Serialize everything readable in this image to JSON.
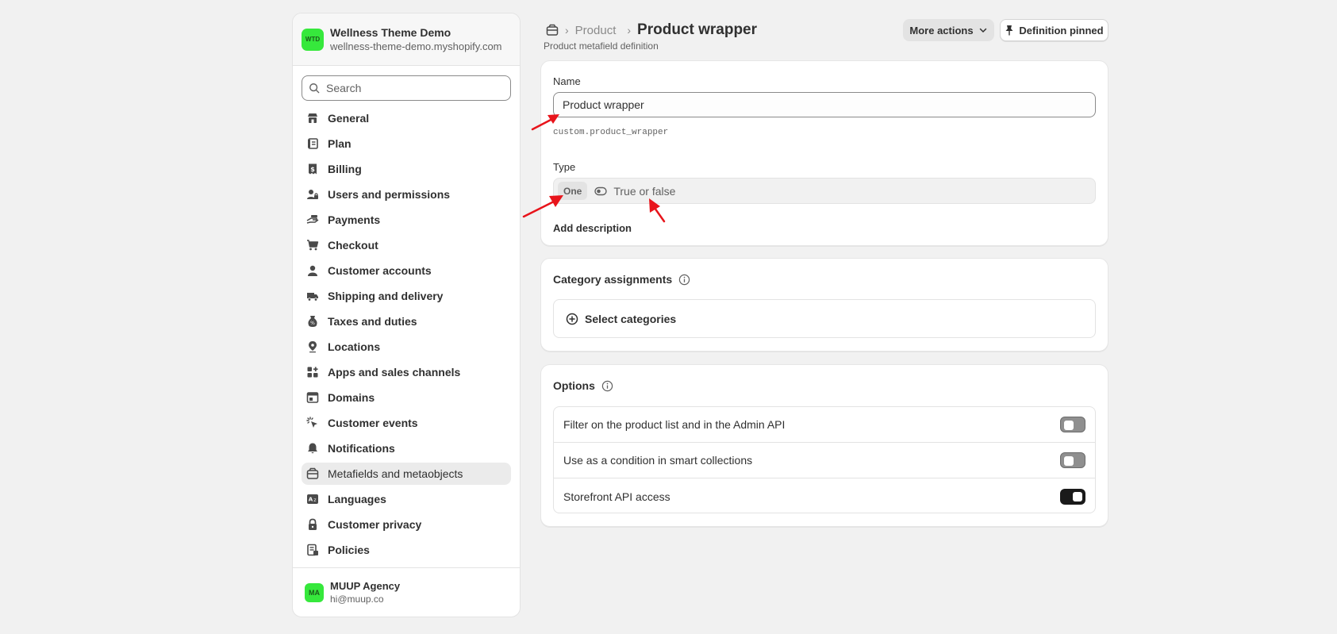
{
  "store": {
    "avatar_initials": "WTD",
    "name": "Wellness Theme Demo",
    "domain": "wellness-theme-demo.myshopify.com"
  },
  "search": {
    "placeholder": "Search"
  },
  "nav": [
    {
      "label": "General",
      "icon": "store-icon"
    },
    {
      "label": "Plan",
      "icon": "plan-icon"
    },
    {
      "label": "Billing",
      "icon": "billing-icon"
    },
    {
      "label": "Users and permissions",
      "icon": "users-icon"
    },
    {
      "label": "Payments",
      "icon": "payments-icon"
    },
    {
      "label": "Checkout",
      "icon": "cart-icon"
    },
    {
      "label": "Customer accounts",
      "icon": "person-icon"
    },
    {
      "label": "Shipping and delivery",
      "icon": "truck-icon"
    },
    {
      "label": "Taxes and duties",
      "icon": "taxes-icon"
    },
    {
      "label": "Locations",
      "icon": "location-icon"
    },
    {
      "label": "Apps and sales channels",
      "icon": "apps-icon"
    },
    {
      "label": "Domains",
      "icon": "globe-icon"
    },
    {
      "label": "Customer events",
      "icon": "cursor-icon"
    },
    {
      "label": "Notifications",
      "icon": "bell-icon"
    },
    {
      "label": "Metafields and metaobjects",
      "icon": "metafields-icon",
      "active": true
    },
    {
      "label": "Languages",
      "icon": "language-icon"
    },
    {
      "label": "Customer privacy",
      "icon": "lock-icon"
    },
    {
      "label": "Policies",
      "icon": "policy-icon"
    }
  ],
  "user": {
    "avatar_initials": "MA",
    "name": "MUUP Agency",
    "email": "hi@muup.co"
  },
  "header": {
    "breadcrumb_parent": "Product",
    "title": "Product wrapper",
    "subtitle": "Product metafield definition",
    "more_actions": "More actions",
    "pinned": "Definition pinned"
  },
  "definition": {
    "name_label": "Name",
    "name_value": "Product wrapper",
    "namespace_key": "custom.product_wrapper",
    "type_label": "Type",
    "type_badge": "One",
    "type_value": "True or false",
    "add_description": "Add description"
  },
  "categories": {
    "title": "Category assignments",
    "select_label": "Select categories"
  },
  "options": {
    "title": "Options",
    "rows": [
      {
        "label": "Filter on the product list and in the Admin API",
        "enabled": false
      },
      {
        "label": "Use as a condition in smart collections",
        "enabled": false
      },
      {
        "label": "Storefront API access",
        "enabled": true
      }
    ]
  },
  "colors": {
    "accent_green": "#36e83c",
    "annotation_red": "#e8141b",
    "toggle_on": "#1a1a1a"
  }
}
